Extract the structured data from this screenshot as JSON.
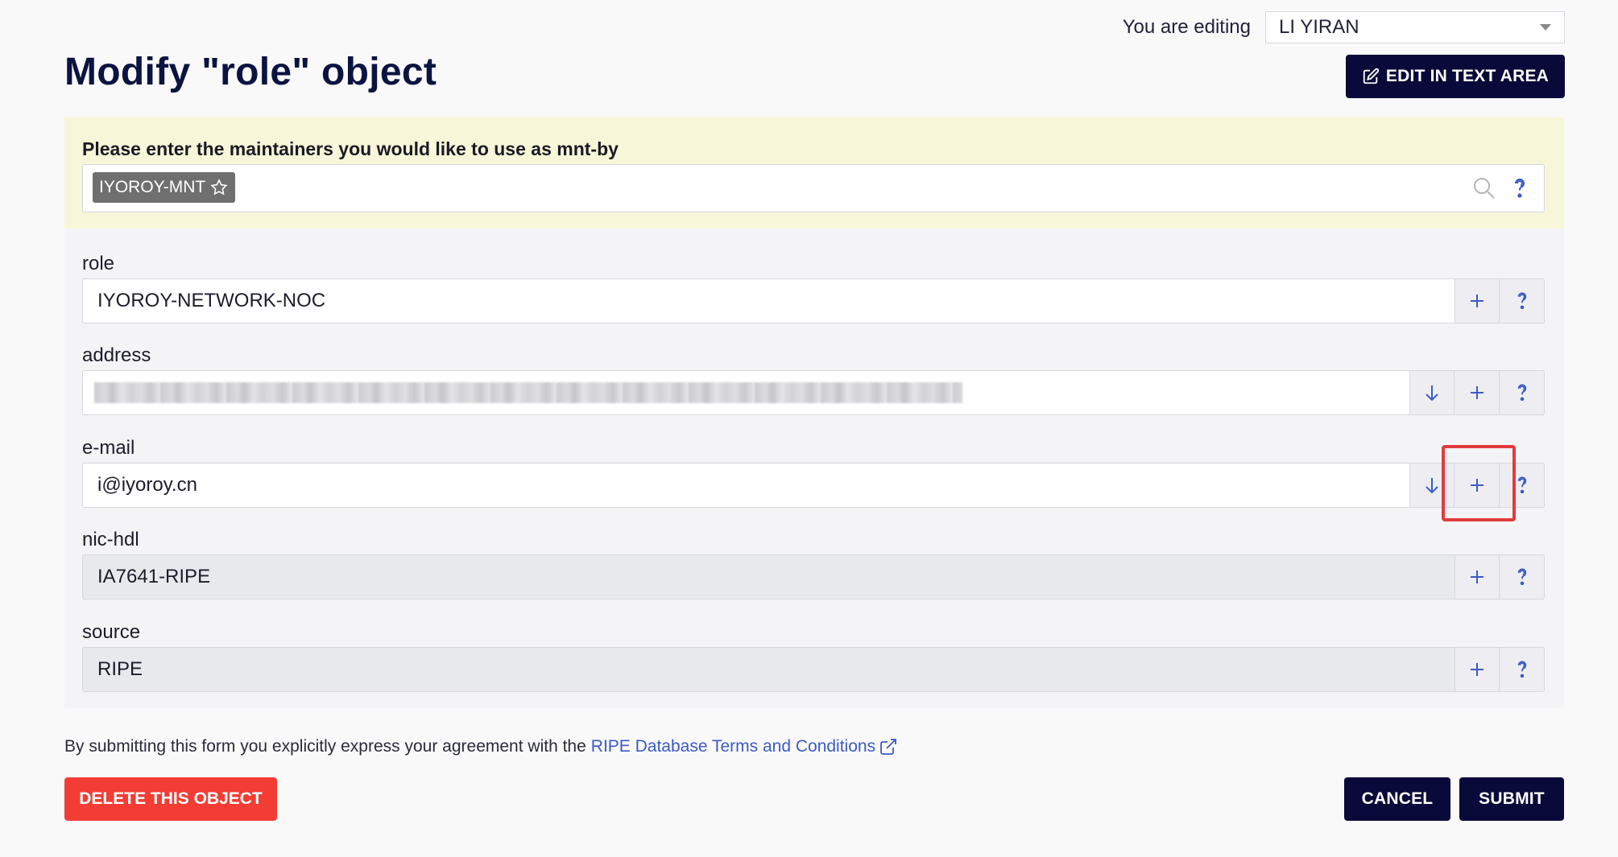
{
  "header": {
    "editing_label": "You are editing",
    "editing_value": "LI YIRAN",
    "title": "Modify \"role\" object",
    "edit_text_area_label": "EDIT IN TEXT AREA"
  },
  "maintainers": {
    "title": "Please enter the maintainers you would like to use as mnt-by",
    "tags": [
      "IYOROY-MNT"
    ]
  },
  "fields": [
    {
      "label": "role",
      "value": "IYOROY-NETWORK-NOC",
      "readonly": false,
      "buttons": [
        "add",
        "help"
      ]
    },
    {
      "label": "address",
      "value": "",
      "redacted": true,
      "readonly": false,
      "buttons": [
        "move-down",
        "add",
        "help"
      ]
    },
    {
      "label": "e-mail",
      "value": "i@iyoroy.cn",
      "readonly": false,
      "buttons": [
        "move-down",
        "add",
        "help"
      ]
    },
    {
      "label": "nic-hdl",
      "value": "IA7641-RIPE",
      "readonly": true,
      "buttons": [
        "add",
        "help"
      ]
    },
    {
      "label": "source",
      "value": "RIPE",
      "readonly": true,
      "buttons": [
        "add",
        "help"
      ]
    }
  ],
  "footer": {
    "terms_text": "By submitting this form you explicitly express your agreement with the",
    "terms_link": "RIPE Database Terms and Conditions",
    "delete_label": "DELETE THIS OBJECT",
    "cancel_label": "CANCEL",
    "submit_label": "SUBMIT"
  },
  "colors": {
    "primary_dark": "#0a0a3a",
    "danger": "#f23c34",
    "link": "#3b5bc4",
    "highlight": "#e23b3b",
    "maintainer_panel": "#f8f6d8"
  }
}
